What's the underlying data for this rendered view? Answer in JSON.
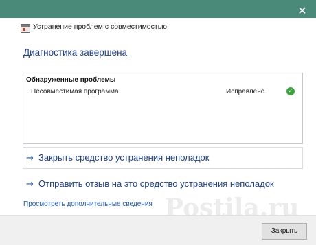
{
  "window": {
    "title": "Устранение проблем с совместимостью"
  },
  "main": {
    "heading": "Диагностика завершена",
    "problems": {
      "header": "Обнаруженные проблемы",
      "items": [
        {
          "name": "Несовместимая программа",
          "status": "Исправлено",
          "status_icon": "check-icon"
        }
      ]
    },
    "actions": [
      {
        "label": "Закрыть средство устранения неполадок"
      },
      {
        "label": "Отправить отзыв на это средство устранения неполадок"
      }
    ],
    "more_link": "Просмотреть дополнительные сведения"
  },
  "footer": {
    "close_button": "Закрыть"
  },
  "watermark": "Postila.ru",
  "colors": {
    "titlebar": "#4a8a78",
    "link": "#1c3f94",
    "check": "#3aa53a"
  }
}
